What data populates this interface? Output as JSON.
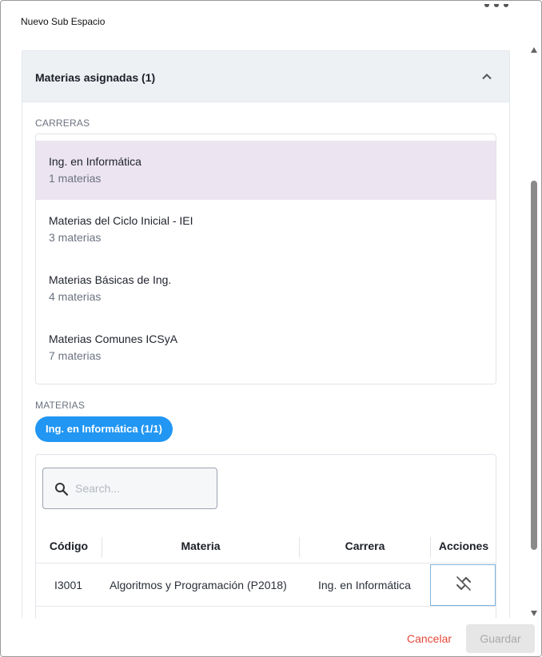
{
  "dialog": {
    "title": "Nuevo Sub Espacio"
  },
  "section": {
    "title": "Materias asignadas (1)",
    "careers_label": "CARRERAS",
    "careers": [
      {
        "name": "Ing. en Informática",
        "count": "1 materias",
        "selected": true
      },
      {
        "name": "Materias del Ciclo Inicial - IEI",
        "count": "3 materias",
        "selected": false
      },
      {
        "name": "Materias Básicas de Ing.",
        "count": "4 materias",
        "selected": false
      },
      {
        "name": "Materias Comunes ICSyA",
        "count": "7 materias",
        "selected": false
      }
    ],
    "subjects_label": "MATERIAS",
    "chip": "Ing. en Informática (1/1)"
  },
  "table": {
    "search_placeholder": "Search...",
    "search_value": "",
    "columns": [
      "Código",
      "Materia",
      "Carrera",
      "Acciones"
    ],
    "rows": [
      {
        "code": "I3001",
        "subject": "Algoritmos y Programación (P2018)",
        "career": "Ing. en Informática",
        "action_icon": "unlink-icon"
      }
    ]
  },
  "footer": {
    "cancel_label": "Cancelar",
    "save_label": "Guardar"
  },
  "icons": {
    "collapse": "chevron-up-icon",
    "search": "search-icon"
  },
  "colors": {
    "accent": "#2196f3",
    "selected_row": "#ece4f1",
    "cancel": "#e5493a",
    "header_bg": "#eef1f4"
  }
}
